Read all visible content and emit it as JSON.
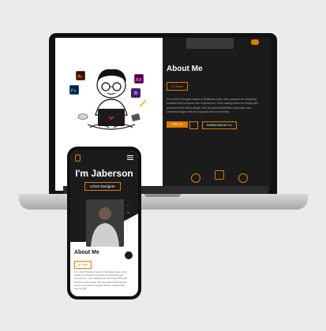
{
  "colors": {
    "accent": "#e07b00",
    "dark": "#1b1b1b",
    "background": "#ebebeb"
  },
  "laptop": {
    "about_title": "About Me",
    "greeting_badge": "Hi There",
    "description": "I'm a UI/UX Designer based in Tamilnadu India, with a passion for designing beautiful and functional user experiences. I love making ideas into things with great and fresh clean design. We care about aesthetics and create user-centered designs that are impactful and user-friendly.",
    "hire_button": "HIRE US",
    "download_button": "DOWNLOAD MY CV",
    "hero_icons": [
      "ai-icon",
      "ps-icon",
      "xd-icon",
      "figma-icon",
      "pencil-icon",
      "phone-icon",
      "mouse-icon"
    ]
  },
  "phone": {
    "name": "I'm Jaberson",
    "role": "UI/UX Designer",
    "social": [
      "in",
      "Be",
      "Dr",
      "f"
    ],
    "about_title": "About Me",
    "greeting_badge": "Hi There",
    "description": "I'm a UI/UX Designer based in Tamilnadu India, with a passion for designing beautiful and functional user experiences. I love making ideas into things with great and fresh clean design. We care about aesthetics and create user-centered designs that are impactful and user-friendly."
  }
}
